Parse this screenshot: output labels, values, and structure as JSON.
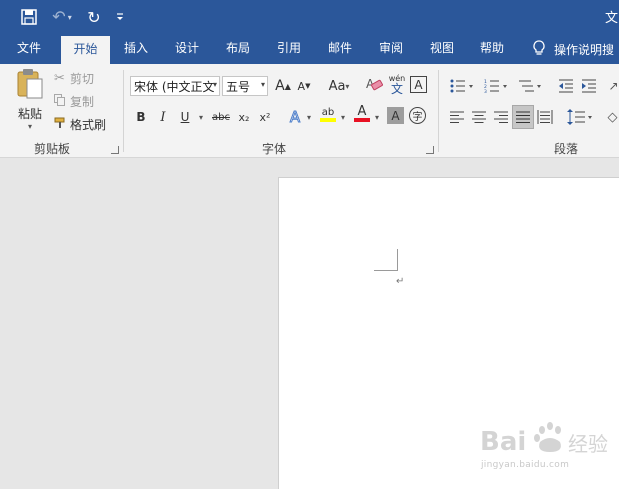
{
  "window": {
    "title_partial": "文"
  },
  "quick_access": {
    "save_icon": "save-icon",
    "undo_icon": "undo-icon",
    "redo_icon": "repeat-icon",
    "customize_icon": "customize-qat-icon"
  },
  "tabs": [
    {
      "label": "文件",
      "active": false
    },
    {
      "label": "开始",
      "active": true
    },
    {
      "label": "插入",
      "active": false
    },
    {
      "label": "设计",
      "active": false
    },
    {
      "label": "布局",
      "active": false
    },
    {
      "label": "引用",
      "active": false
    },
    {
      "label": "邮件",
      "active": false
    },
    {
      "label": "审阅",
      "active": false
    },
    {
      "label": "视图",
      "active": false
    },
    {
      "label": "帮助",
      "active": false
    }
  ],
  "tell_me": {
    "label": "操作说明搜",
    "icon": "lightbulb-icon"
  },
  "clipboard": {
    "group_label": "剪贴板",
    "paste_label": "粘贴",
    "cut_label": "剪切",
    "copy_label": "复制",
    "format_painter_label": "格式刷"
  },
  "font": {
    "group_label": "字体",
    "font_name": "宋体 (中文正文",
    "font_size": "五号",
    "case_label": "Aa",
    "pinyin_top": "wén",
    "pinyin_bottom": "文",
    "border_char": "A",
    "bold": "B",
    "italic": "I",
    "underline": "U",
    "strike": "abc",
    "subscript": "x₂",
    "superscript": "x²",
    "text_effect": "A",
    "highlight": "ab",
    "font_color": "A",
    "char_shading": "A",
    "enclose": "字",
    "grow": "A",
    "shrink": "A"
  },
  "paragraph": {
    "group_label": "段落"
  },
  "colors": {
    "brand": "#2b579a",
    "ribbon": "#f3f3f3",
    "highlight_yellow": "#ffff00",
    "font_red": "#e81123",
    "effect_blue": "#4a7cc9"
  },
  "document": {
    "paragraph_mark": "↵"
  },
  "watermark": {
    "brand": "Bai 经验",
    "url": "jingyan.baidu.com"
  }
}
